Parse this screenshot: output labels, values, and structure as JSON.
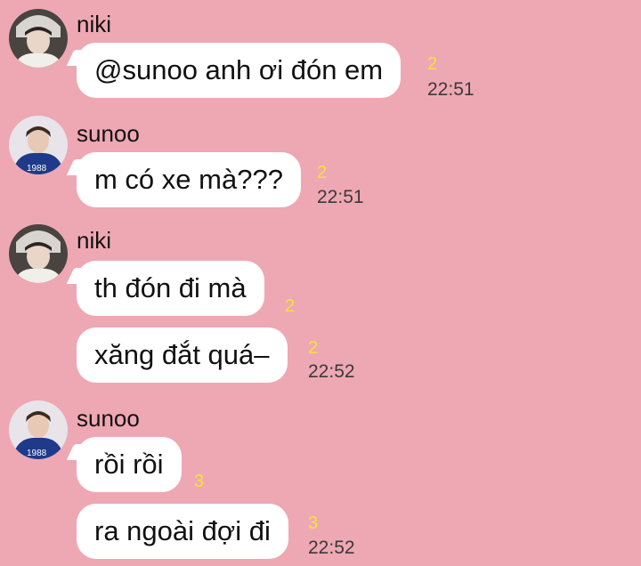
{
  "colors": {
    "background": "#eea8b3",
    "bubble": "#ffffff",
    "unread": "#f4e23a"
  },
  "messages": [
    {
      "sender": "niki",
      "avatar": "niki-avatar-icon",
      "text": "@sunoo anh ơi đón em",
      "unread": "2",
      "time": "22:51"
    },
    {
      "sender": "sunoo",
      "avatar": "sunoo-avatar-icon",
      "text": "m có xe mà???",
      "unread": "2",
      "time": "22:51"
    },
    {
      "sender": "niki",
      "avatar": "niki-avatar-icon",
      "text": "th đón đi mà",
      "unread": "2",
      "time": ""
    },
    {
      "sender": "",
      "text": "xăng đắt quá–",
      "unread": "2",
      "time": "22:52"
    },
    {
      "sender": "sunoo",
      "avatar": "sunoo-avatar-icon",
      "text": "rồi rồi",
      "unread": "3",
      "time": ""
    },
    {
      "sender": "",
      "text": "ra ngoài đợi đi",
      "unread": "3",
      "time": "22:52"
    }
  ]
}
